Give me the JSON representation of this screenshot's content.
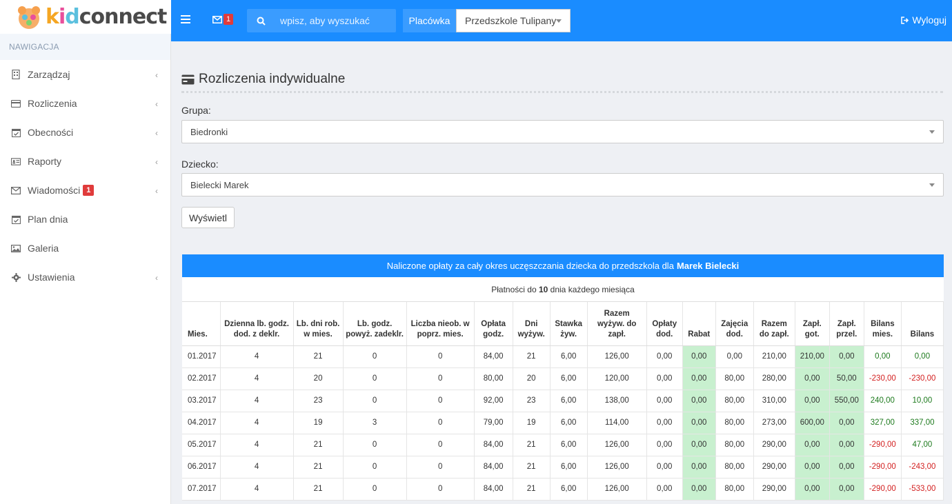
{
  "app": {
    "logo_text_kid": "kid",
    "logo_text_rest": "connect"
  },
  "topbar": {
    "mail_count": "1",
    "search_placeholder": "wpisz, aby wyszukać",
    "placowka_label": "Placówka",
    "placowka_value": "Przedszkole Tulipany",
    "logout_label": "Wyloguj"
  },
  "sidebar": {
    "header": "NAWIGACJA",
    "items": [
      {
        "label": "Zarządzaj",
        "icon": "building-icon",
        "chevron": true
      },
      {
        "label": "Rozliczenia",
        "icon": "credit-card-icon",
        "chevron": true
      },
      {
        "label": "Obecności",
        "icon": "calendar-check-icon",
        "chevron": true
      },
      {
        "label": "Raporty",
        "icon": "id-card-icon",
        "chevron": true
      },
      {
        "label": "Wiadomości",
        "icon": "envelope-icon",
        "chevron": true,
        "badge": "1"
      },
      {
        "label": "Plan dnia",
        "icon": "calendar-icon",
        "chevron": false
      },
      {
        "label": "Galeria",
        "icon": "image-icon",
        "chevron": false
      },
      {
        "label": "Ustawienia",
        "icon": "gear-icon",
        "chevron": true
      }
    ]
  },
  "page": {
    "title": "Rozliczenia indywidualne",
    "group_label": "Grupa:",
    "group_value": "Biedronki",
    "child_label": "Dziecko:",
    "child_value": "Bielecki Marek",
    "show_button": "Wyświetl"
  },
  "table": {
    "heading_prefix": "Naliczone opłaty za cały okres uczęszczania dziecka do przedszkola dla",
    "heading_name": "Marek Bielecki",
    "sub_prefix": "Płatności do",
    "sub_day": "10",
    "sub_suffix": "dnia każdego miesiąca",
    "columns": [
      "Mies.",
      "Dzienna lb. godz. dod. z deklr.",
      "Lb. dni rob. w mies.",
      "Lb. godz. powyż. zadeklr.",
      "Liczba nieob. w poprz. mies.",
      "Opłata godz.",
      "Dni wyżyw.",
      "Stawka żyw.",
      "Razem wyżyw. do zapł.",
      "Opłaty dod.",
      "Rabat",
      "Zajęcia dod.",
      "Razem do zapł.",
      "Zapł. got.",
      "Zapł. przel.",
      "Bilans mies.",
      "Bilans"
    ],
    "rows": [
      [
        "01.2017",
        "4",
        "21",
        "0",
        "0",
        "84,00",
        "21",
        "6,00",
        "126,00",
        "0,00",
        "0,00",
        "0,00",
        "210,00",
        "210,00",
        "0,00",
        "0,00",
        "0,00"
      ],
      [
        "02.2017",
        "4",
        "20",
        "0",
        "0",
        "80,00",
        "20",
        "6,00",
        "120,00",
        "0,00",
        "0,00",
        "80,00",
        "280,00",
        "0,00",
        "50,00",
        "-230,00",
        "-230,00"
      ],
      [
        "03.2017",
        "4",
        "23",
        "0",
        "0",
        "92,00",
        "23",
        "6,00",
        "138,00",
        "0,00",
        "0,00",
        "80,00",
        "310,00",
        "0,00",
        "550,00",
        "240,00",
        "10,00"
      ],
      [
        "04.2017",
        "4",
        "19",
        "3",
        "0",
        "79,00",
        "19",
        "6,00",
        "114,00",
        "0,00",
        "0,00",
        "80,00",
        "273,00",
        "600,00",
        "0,00",
        "327,00",
        "337,00"
      ],
      [
        "05.2017",
        "4",
        "21",
        "0",
        "0",
        "84,00",
        "21",
        "6,00",
        "126,00",
        "0,00",
        "0,00",
        "80,00",
        "290,00",
        "0,00",
        "0,00",
        "-290,00",
        "47,00"
      ],
      [
        "06.2017",
        "4",
        "21",
        "0",
        "0",
        "84,00",
        "21",
        "6,00",
        "126,00",
        "0,00",
        "0,00",
        "80,00",
        "290,00",
        "0,00",
        "0,00",
        "-290,00",
        "-243,00"
      ],
      [
        "07.2017",
        "4",
        "21",
        "0",
        "0",
        "84,00",
        "21",
        "6,00",
        "126,00",
        "0,00",
        "0,00",
        "80,00",
        "290,00",
        "0,00",
        "0,00",
        "-290,00",
        "-533,00"
      ]
    ]
  },
  "colors": {
    "primary": "#1a8cff",
    "badge": "#e03b3b",
    "green_cell": "#c8f0cf",
    "positive": "#1d7a1d",
    "negative": "#d32020"
  }
}
